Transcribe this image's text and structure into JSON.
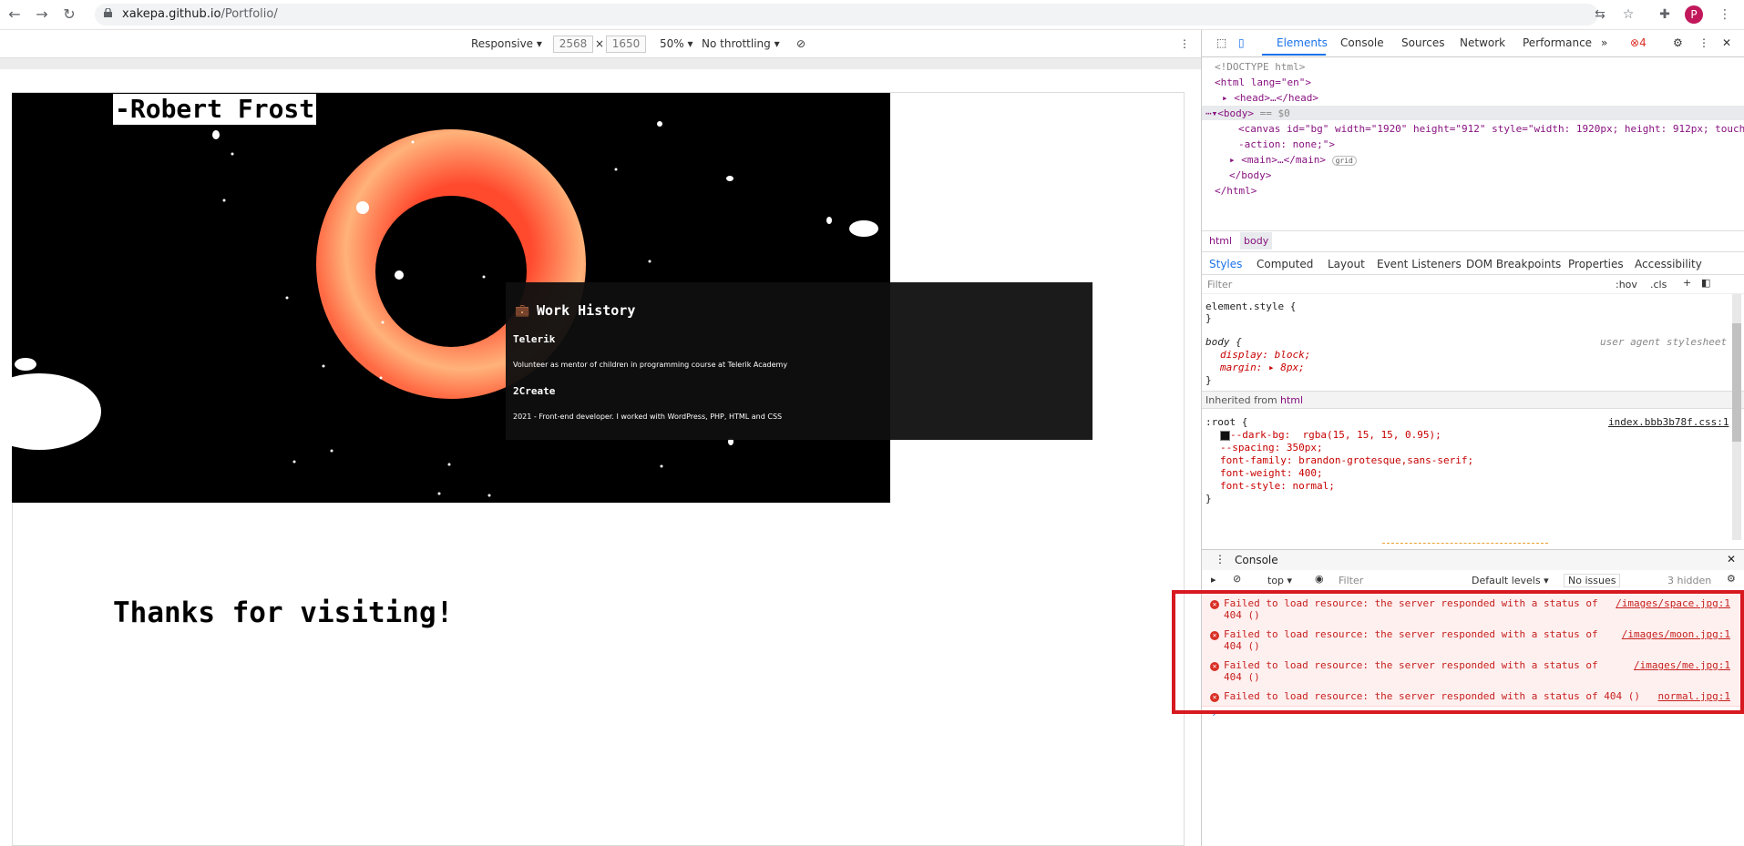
{
  "browser": {
    "url_host": "xakepa.github.io",
    "url_path": "/Portfolio/",
    "avatar_letter": "P"
  },
  "device_toolbar": {
    "mode": "Responsive",
    "width": "2568",
    "times": "×",
    "height": "1650",
    "zoom": "50%",
    "throttling": "No throttling"
  },
  "page": {
    "quote_author": "-Robert Frost",
    "card": {
      "title": "Work History",
      "jobs": [
        {
          "company": "Telerik",
          "desc": "Volunteer as mentor of children in programming course at Telerik Academy"
        },
        {
          "company": "2Create",
          "desc": "2021 - Front-end developer. I worked with WordPress, PHP, HTML and CSS"
        }
      ]
    },
    "thanks": "Thanks for visiting!",
    "colors": {
      "canvas_bg": "#000000",
      "torus_outer": "#ff5a3c",
      "torus_inner": "#ffc07a"
    }
  },
  "devtools": {
    "tabs": [
      "Elements",
      "Console",
      "Sources",
      "Network",
      "Performance"
    ],
    "more": "»",
    "error_count": "4",
    "dom": {
      "doctype": "<!DOCTYPE html>",
      "html_open": "<html lang=\"en\">",
      "head": "<head>…</head>",
      "body_open": "<body>",
      "body_suffix": " == $0",
      "canvas_line1": "<canvas id=\"bg\" width=\"1920\" height=\"912\" style=\"width: 1920px; height: 912px; touch",
      "canvas_line2": "-action: none;\">",
      "main": "<main>…</main>",
      "main_badge": "grid",
      "body_close": "</body>",
      "html_close": "</html>"
    },
    "breadcrumbs": [
      "html",
      "body"
    ],
    "subtabs": [
      "Styles",
      "Computed",
      "Layout",
      "Event Listeners",
      "DOM Breakpoints",
      "Properties",
      "Accessibility"
    ],
    "filter_placeholder": "Filter",
    "hov": ":hov",
    "cls": ".cls",
    "styles": {
      "element_style_open": "element.style {",
      "close": "}",
      "body_selector": "body {",
      "body_source": "user agent stylesheet",
      "body_props": [
        "display: block;",
        "margin: ▸ 8px;"
      ],
      "inherited_label": "Inherited from",
      "inherited_tag": "html",
      "root_selector": ":root {",
      "root_source": "index.bbb3b78f.css:1",
      "root_props": [
        "--dark-bg:  rgba(15, 15, 15, 0.95);",
        "--spacing: 350px;",
        "font-family: brandon-grotesque,sans-serif;",
        "font-weight: 400;",
        "font-style: normal;"
      ]
    },
    "console": {
      "title": "Console",
      "context": "top",
      "filter_placeholder": "Filter",
      "levels": "Default levels",
      "issues": "No issues",
      "hidden": "3 hidden",
      "errors": [
        {
          "line1": "Failed to load resource: the server responded with a status of",
          "line2": "404 ()",
          "source": "/images/space.jpg:1"
        },
        {
          "line1": "Failed to load resource: the server responded with a status of",
          "line2": "404 ()",
          "source": "/images/moon.jpg:1"
        },
        {
          "line1": "Failed to load resource: the server responded with a status of",
          "line2": "404 ()",
          "source": "/images/me.jpg:1"
        },
        {
          "line1": "Failed to load resource: the server responded with a status of 404 ()",
          "line2": "",
          "source": "normal.jpg:1"
        }
      ],
      "prompt": "›"
    }
  }
}
